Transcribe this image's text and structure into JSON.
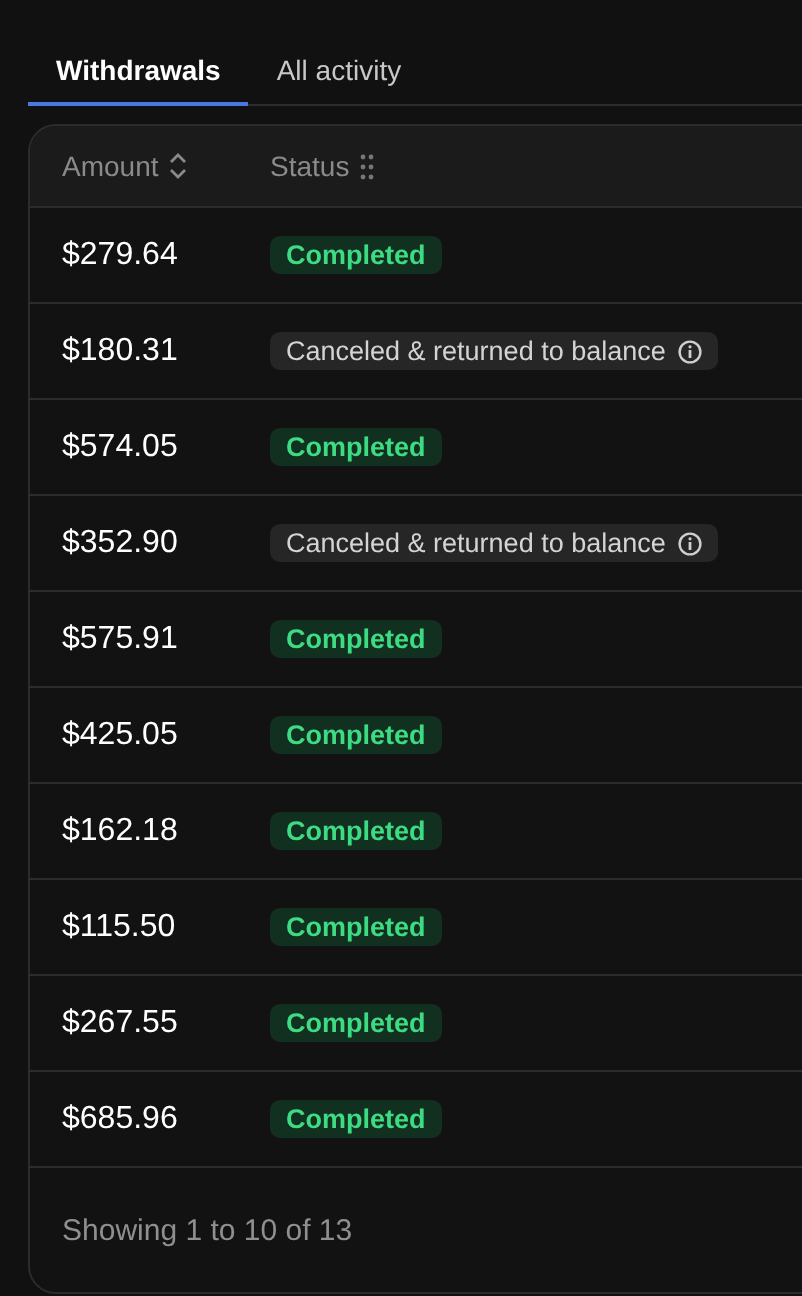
{
  "tabs": [
    {
      "label": "Withdrawals",
      "selected": true
    },
    {
      "label": "All activity",
      "selected": false
    }
  ],
  "table": {
    "columns": [
      {
        "label": "Amount",
        "kind": "sortable"
      },
      {
        "label": "Status",
        "kind": "draggable"
      }
    ],
    "rows": [
      {
        "amount": "$279.64",
        "status": {
          "kind": "completed",
          "label": "Completed"
        }
      },
      {
        "amount": "$180.31",
        "status": {
          "kind": "canceled",
          "label": "Canceled & returned to balance"
        }
      },
      {
        "amount": "$574.05",
        "status": {
          "kind": "completed",
          "label": "Completed"
        }
      },
      {
        "amount": "$352.90",
        "status": {
          "kind": "canceled",
          "label": "Canceled & returned to balance"
        }
      },
      {
        "amount": "$575.91",
        "status": {
          "kind": "completed",
          "label": "Completed"
        }
      },
      {
        "amount": "$425.05",
        "status": {
          "kind": "completed",
          "label": "Completed"
        }
      },
      {
        "amount": "$162.18",
        "status": {
          "kind": "completed",
          "label": "Completed"
        }
      },
      {
        "amount": "$115.50",
        "status": {
          "kind": "completed",
          "label": "Completed"
        }
      },
      {
        "amount": "$267.55",
        "status": {
          "kind": "completed",
          "label": "Completed"
        }
      },
      {
        "amount": "$685.96",
        "status": {
          "kind": "completed",
          "label": "Completed"
        }
      }
    ],
    "footer": "Showing 1 to 10 of 13"
  }
}
